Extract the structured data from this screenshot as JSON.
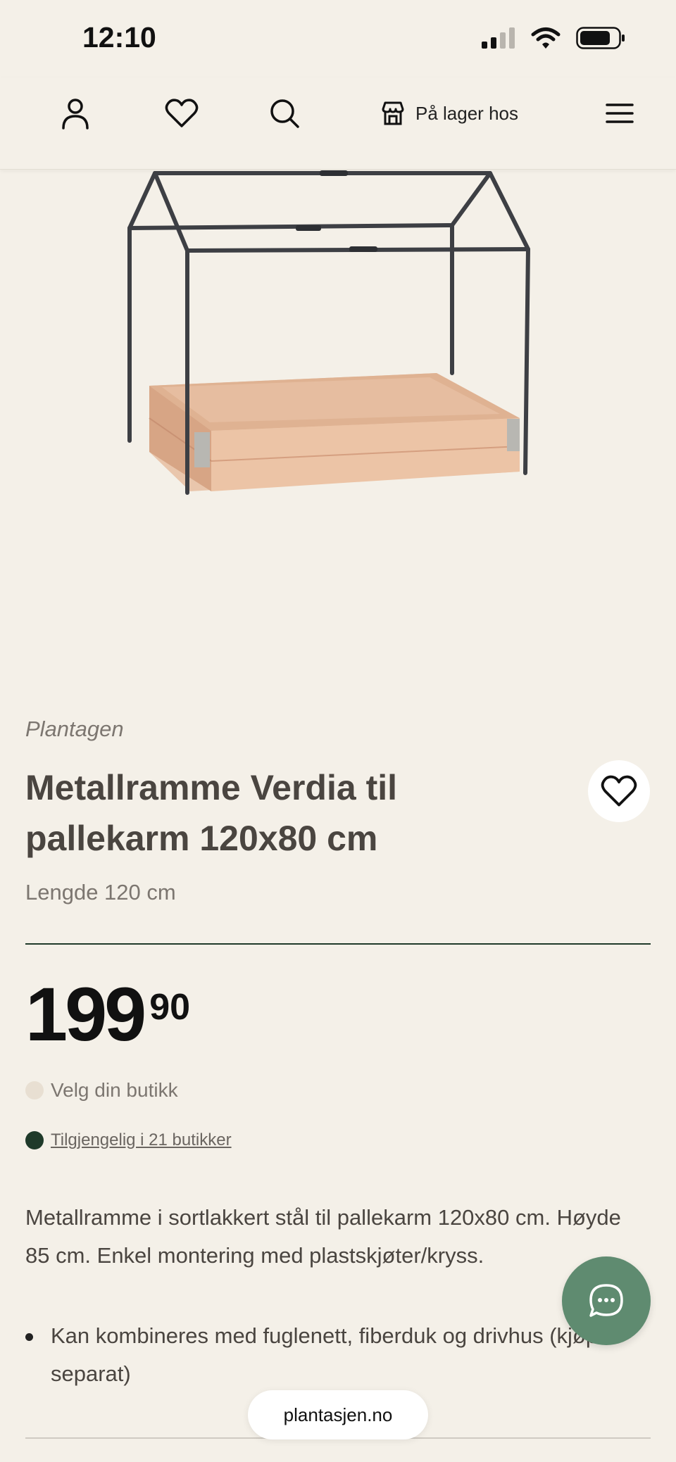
{
  "status_bar": {
    "time": "12:10",
    "battery_level": 0.8
  },
  "header": {
    "store_link_label": "På lager hos",
    "icons": [
      "account-icon",
      "heart-icon",
      "search-icon",
      "store-icon",
      "menu-icon"
    ]
  },
  "product": {
    "brand": "Plantagen",
    "title": "Metallramme Verdia til pallekarm 120x80 cm",
    "variant": "Lengde 120 cm",
    "price_main": "199",
    "price_cents": "90",
    "select_store_label": "Velg din butikk",
    "availability_label": "Tilgjengelig i 21 butikker",
    "description": "Metallramme i sortlakkert stål til pallekarm 120x80 cm. Høyde 85 cm. Enkel montering med plastskjøter/kryss.",
    "bullets": [
      "Kan kombineres med fuglenett, fiberduk og drivhus (kjøpes separat)"
    ]
  },
  "colors": {
    "background": "#f4f0e8",
    "availability_dot": "#1f3a2a",
    "store_dot": "#e8dfd2",
    "chat_button": "#5f8b70",
    "divider": "#1f3a2a"
  },
  "browser": {
    "url": "plantasjen.no"
  }
}
